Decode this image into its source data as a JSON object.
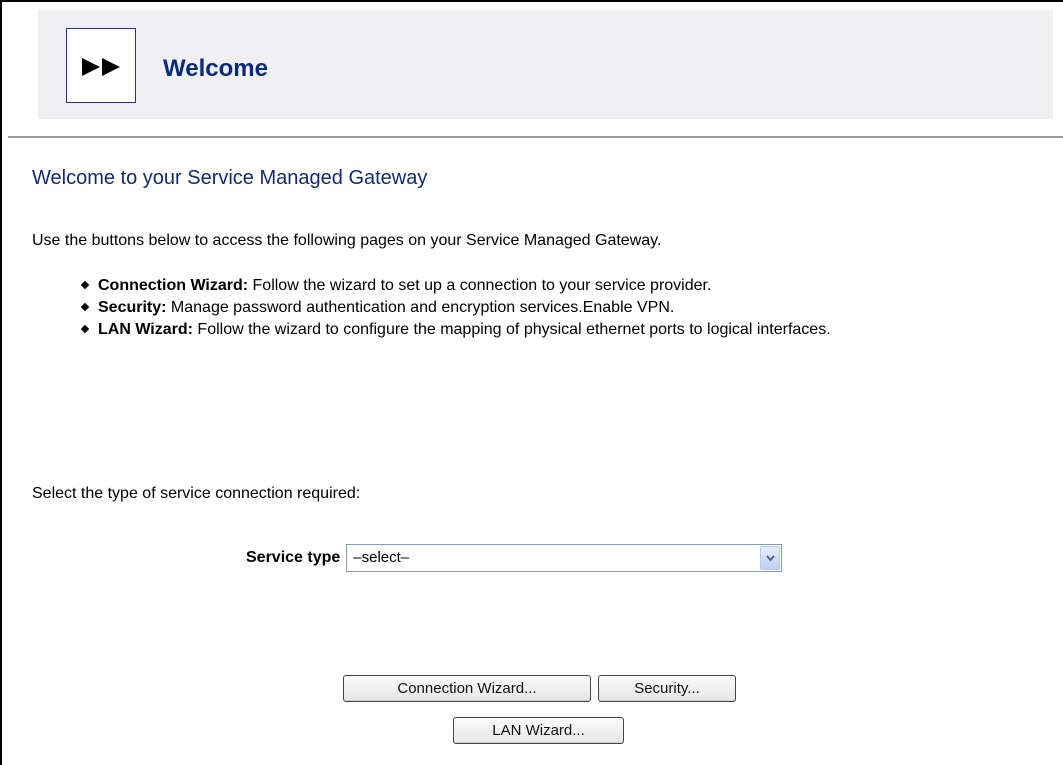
{
  "header": {
    "title": "Welcome",
    "icon": "fast-forward-icon"
  },
  "main": {
    "page_title": "Welcome to your Service Managed Gateway",
    "intro": "Use the buttons below to access the following pages on your Service Managed Gateway.",
    "features": [
      {
        "name": "Connection Wizard:",
        "description": " Follow the wizard to set up a connection to your service provider."
      },
      {
        "name": "Security:",
        "description": " Manage password authentication and encryption services.Enable VPN."
      },
      {
        "name": "LAN Wizard:",
        "description": " Follow the wizard to configure the mapping of physical ethernet ports to logical interfaces."
      }
    ],
    "select_prompt": "Select the type of service connection required:",
    "service_type": {
      "label": "Service type",
      "selected": "–select–"
    }
  },
  "buttons": {
    "connection_wizard": "Connection Wizard...",
    "security": "Security...",
    "lan_wizard": "LAN Wizard..."
  },
  "colors": {
    "header_background": "#f0f0f3",
    "title_blue": "#0a2a7a",
    "heading_blue": "#102c6e"
  }
}
